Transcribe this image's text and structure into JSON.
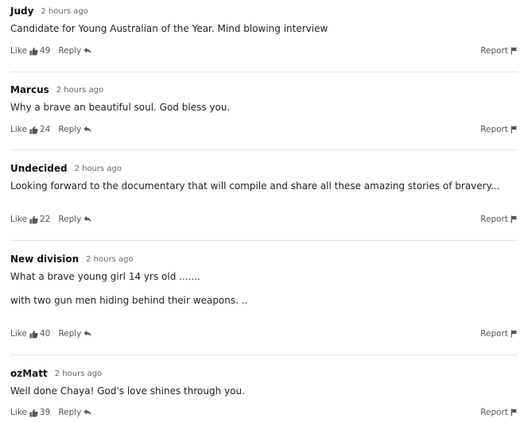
{
  "ui": {
    "like_label": "Like",
    "reply_label": "Reply",
    "report_label": "Report",
    "icons": {
      "like": "thumbs-up-icon",
      "reply": "reply-arrow-icon",
      "report": "flag-icon"
    }
  },
  "comments": [
    {
      "author": "Judy",
      "time": "2 hours ago",
      "text": [
        "Candidate for Young Australian of the Year. Mind blowing interview"
      ],
      "likes": "49"
    },
    {
      "author": "Marcus",
      "time": "2 hours ago",
      "text": [
        "Why a brave an beautiful soul. God bless you."
      ],
      "likes": "24"
    },
    {
      "author": "Undecided",
      "time": "2 hours ago",
      "text": [
        "Looking forward to the documentary that will compile and share all these amazing stories of bravery..."
      ],
      "likes": "22"
    },
    {
      "author": "New division",
      "time": "2 hours ago",
      "text": [
        "What a brave young girl  14 yrs old .......",
        "with two gun men hiding behind their weapons. .."
      ],
      "likes": "40"
    },
    {
      "author": "ozMatt",
      "time": "2 hours ago",
      "text": [
        "Well done Chaya!  God's love shines through you."
      ],
      "likes": "39"
    }
  ]
}
